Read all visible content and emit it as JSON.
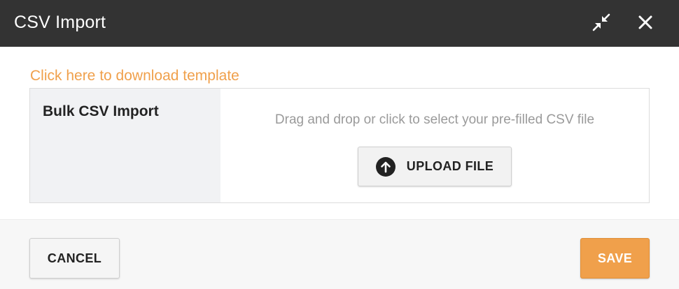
{
  "dialog": {
    "title": "CSV Import",
    "icons": {
      "minimize": "minimize-arrows-icon",
      "close": "close-icon"
    }
  },
  "template_link": {
    "label": "Click here to download template"
  },
  "import": {
    "label": "Bulk CSV Import",
    "dropzone_text": "Drag and drop or click to select your pre-filled CSV file",
    "upload_button_label": "UPLOAD FILE",
    "upload_icon": "upload-arrow-circle-icon"
  },
  "footer": {
    "cancel_label": "CANCEL",
    "save_label": "SAVE"
  },
  "colors": {
    "titlebar_bg": "#333333",
    "accent": "#f0a04b",
    "label_cell_bg": "#f1f2f4",
    "footer_bg": "#f7f7f7"
  }
}
